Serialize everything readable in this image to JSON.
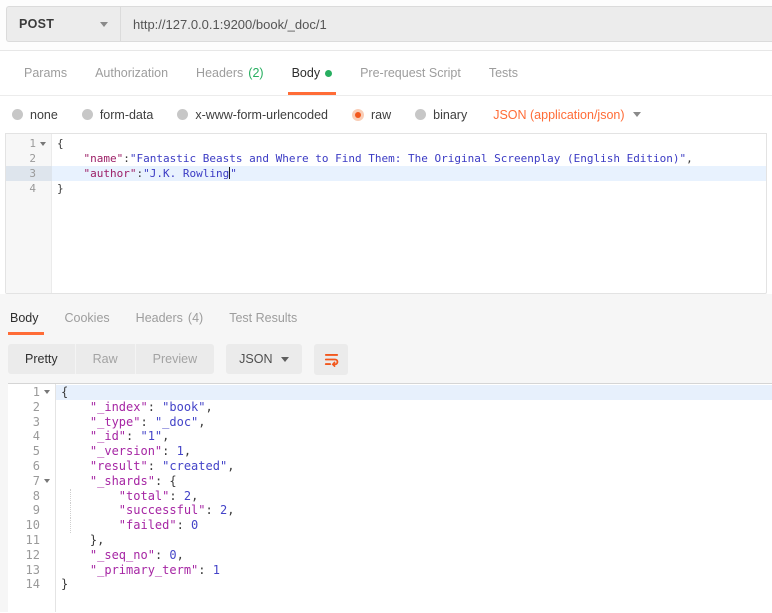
{
  "colors": {
    "accent_orange": "#ff6c37",
    "count_green": "#27ae60",
    "request_key": "#9c1e66",
    "request_string": "#3b3bc4",
    "response_key": "#a626a4",
    "response_string": "#4444c8",
    "response_number": "#4444c8",
    "active_line_bg": "#e7f0fc"
  },
  "request_bar": {
    "method": "POST",
    "url": "http://127.0.0.1:9200/book/_doc/1"
  },
  "request_tabs": {
    "items": [
      {
        "label": "Params"
      },
      {
        "label": "Authorization"
      },
      {
        "label": "Headers",
        "count": "(2)"
      },
      {
        "label": "Body"
      },
      {
        "label": "Pre-request Script"
      },
      {
        "label": "Tests"
      }
    ]
  },
  "body_type": {
    "options": [
      {
        "label": "none"
      },
      {
        "label": "form-data"
      },
      {
        "label": "x-www-form-urlencoded"
      },
      {
        "label": "raw"
      },
      {
        "label": "binary"
      }
    ],
    "raw_format": "JSON (application/json)"
  },
  "request_editor": {
    "lines": [
      {
        "n": 1,
        "fold": true,
        "seg": [
          [
            "{",
            "p"
          ]
        ]
      },
      {
        "n": 2,
        "seg": [
          [
            "    ",
            "p"
          ],
          [
            "\"name\"",
            "k"
          ],
          [
            ":",
            "p"
          ],
          [
            "\"Fantastic Beasts and Where to Find Them: The Original Screenplay (English Edition)\"",
            "s"
          ],
          [
            ",",
            "p"
          ]
        ]
      },
      {
        "n": 3,
        "active": true,
        "seg": [
          [
            "    ",
            "p"
          ],
          [
            "\"author\"",
            "k"
          ],
          [
            ":",
            "p"
          ],
          [
            "\"J.K. Rowling",
            "s"
          ],
          [
            "",
            "cur"
          ],
          [
            "\"",
            "s"
          ]
        ]
      },
      {
        "n": 4,
        "seg": [
          [
            "}",
            "p"
          ]
        ]
      }
    ]
  },
  "response_tabs": {
    "items": [
      {
        "label": "Body"
      },
      {
        "label": "Cookies"
      },
      {
        "label": "Headers",
        "count": "(4)"
      },
      {
        "label": "Test Results"
      }
    ]
  },
  "response_toolbar": {
    "views": [
      {
        "label": "Pretty"
      },
      {
        "label": "Raw"
      },
      {
        "label": "Preview"
      }
    ],
    "format": "JSON",
    "wrap_icon": "text-wrap-icon"
  },
  "response_editor": {
    "lines": [
      {
        "n": 1,
        "fold": true,
        "active": true,
        "seg": [
          [
            "{",
            "p"
          ]
        ]
      },
      {
        "n": 2,
        "seg": [
          [
            "    ",
            "p"
          ],
          [
            "\"_index\"",
            "k"
          ],
          [
            ": ",
            "p"
          ],
          [
            "\"book\"",
            "s"
          ],
          [
            ",",
            "p"
          ]
        ]
      },
      {
        "n": 3,
        "seg": [
          [
            "    ",
            "p"
          ],
          [
            "\"_type\"",
            "k"
          ],
          [
            ": ",
            "p"
          ],
          [
            "\"_doc\"",
            "s"
          ],
          [
            ",",
            "p"
          ]
        ]
      },
      {
        "n": 4,
        "seg": [
          [
            "    ",
            "p"
          ],
          [
            "\"_id\"",
            "k"
          ],
          [
            ": ",
            "p"
          ],
          [
            "\"1\"",
            "s"
          ],
          [
            ",",
            "p"
          ]
        ]
      },
      {
        "n": 5,
        "seg": [
          [
            "    ",
            "p"
          ],
          [
            "\"_version\"",
            "k"
          ],
          [
            ": ",
            "p"
          ],
          [
            "1",
            "n"
          ],
          [
            ",",
            "p"
          ]
        ]
      },
      {
        "n": 6,
        "seg": [
          [
            "    ",
            "p"
          ],
          [
            "\"result\"",
            "k"
          ],
          [
            ": ",
            "p"
          ],
          [
            "\"created\"",
            "s"
          ],
          [
            ",",
            "p"
          ]
        ]
      },
      {
        "n": 7,
        "fold": true,
        "seg": [
          [
            "    ",
            "p"
          ],
          [
            "\"_shards\"",
            "k"
          ],
          [
            ": ",
            "p"
          ],
          [
            "{",
            "p"
          ]
        ]
      },
      {
        "n": 8,
        "guide": true,
        "seg": [
          [
            "        ",
            "p"
          ],
          [
            "\"total\"",
            "k"
          ],
          [
            ": ",
            "p"
          ],
          [
            "2",
            "n"
          ],
          [
            ",",
            "p"
          ]
        ]
      },
      {
        "n": 9,
        "guide": true,
        "seg": [
          [
            "        ",
            "p"
          ],
          [
            "\"successful\"",
            "k"
          ],
          [
            ": ",
            "p"
          ],
          [
            "2",
            "n"
          ],
          [
            ",",
            "p"
          ]
        ]
      },
      {
        "n": 10,
        "guide": true,
        "seg": [
          [
            "        ",
            "p"
          ],
          [
            "\"failed\"",
            "k"
          ],
          [
            ": ",
            "p"
          ],
          [
            "0",
            "n"
          ]
        ]
      },
      {
        "n": 11,
        "seg": [
          [
            "    ",
            "p"
          ],
          [
            "},",
            "p"
          ]
        ]
      },
      {
        "n": 12,
        "seg": [
          [
            "    ",
            "p"
          ],
          [
            "\"_seq_no\"",
            "k"
          ],
          [
            ": ",
            "p"
          ],
          [
            "0",
            "n"
          ],
          [
            ",",
            "p"
          ]
        ]
      },
      {
        "n": 13,
        "seg": [
          [
            "    ",
            "p"
          ],
          [
            "\"_primary_term\"",
            "k"
          ],
          [
            ": ",
            "p"
          ],
          [
            "1",
            "n"
          ]
        ]
      },
      {
        "n": 14,
        "seg": [
          [
            "}",
            "p"
          ]
        ]
      }
    ]
  }
}
